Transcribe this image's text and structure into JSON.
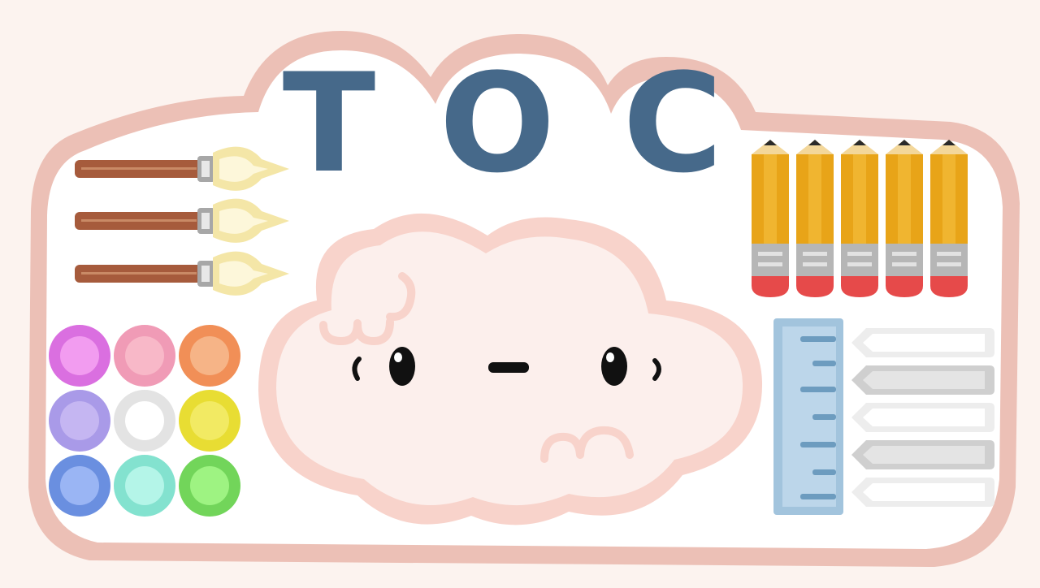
{
  "title": {
    "letters": [
      "T",
      "O",
      "C"
    ],
    "color": "#46698a"
  },
  "colors": {
    "background": "#fcf3ef",
    "board_outline": "#ecc0b6",
    "board_fill": "#ffffff",
    "cloud_outline": "#f8d3cb",
    "cloud_fill": "#fcefec",
    "brush_handle": "#a65b3c",
    "brush_ferrule": "#a7a7a7",
    "brush_tip": "#f4e6a7",
    "pencil_body": "#e8a418",
    "pencil_band": "#b6b6b6",
    "pencil_eraser": "#e64a4a",
    "pencil_lead": "#2a2a2a",
    "ruler": "#a2c4dd",
    "ruler_marks": "#6d9cbf"
  },
  "paint_swatches": [
    {
      "name": "magenta",
      "outer": "#da6fe0",
      "inner": "#f29cf0"
    },
    {
      "name": "pink",
      "outer": "#f09bb6",
      "inner": "#f8b8c8"
    },
    {
      "name": "orange",
      "outer": "#f18f57",
      "inner": "#f6b487"
    },
    {
      "name": "lavender",
      "outer": "#a99ae8",
      "inner": "#c5b6f2"
    },
    {
      "name": "white",
      "outer": "#e3e3e3",
      "inner": "#ffffff"
    },
    {
      "name": "yellow",
      "outer": "#e8dd33",
      "inner": "#f2ea63"
    },
    {
      "name": "blue",
      "outer": "#6a8fe0",
      "inner": "#9ab5f4"
    },
    {
      "name": "mint",
      "outer": "#83e2cf",
      "inner": "#b4f5e8"
    },
    {
      "name": "green",
      "outer": "#72d55a",
      "inner": "#9ef382"
    }
  ],
  "brushes_count": 3,
  "pencils_count": 5,
  "chalk_sticks": [
    {
      "style": "outline"
    },
    {
      "style": "filled"
    },
    {
      "style": "outline"
    },
    {
      "style": "filled"
    },
    {
      "style": "outline"
    }
  ],
  "mascot": {
    "name": "cloud",
    "face": "neutral"
  }
}
